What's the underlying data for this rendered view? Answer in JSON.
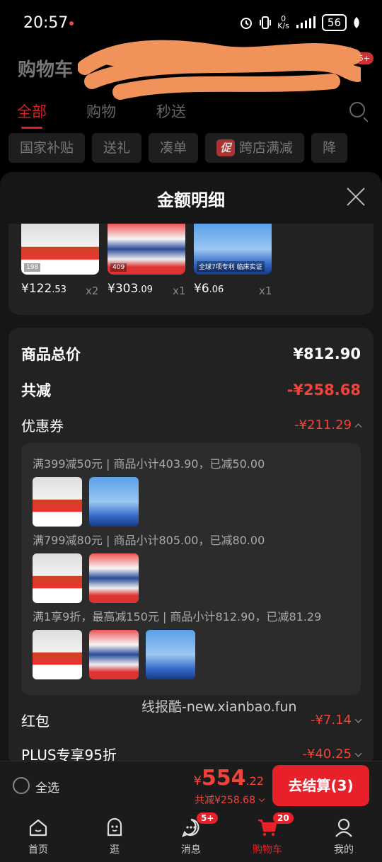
{
  "status_bar": {
    "time": "20:57",
    "net_speed": "0\nK/s",
    "battery": "56"
  },
  "header": {
    "title": "购物车",
    "badge": "5+"
  },
  "tabs": [
    {
      "label": "全部",
      "active": true
    },
    {
      "label": "购物",
      "active": false
    },
    {
      "label": "秒送",
      "active": false
    }
  ],
  "chips": [
    {
      "label": "国家补贴"
    },
    {
      "label": "送礼"
    },
    {
      "label": "凑单"
    },
    {
      "label": "跨店满减",
      "tag": "促"
    },
    {
      "label": "降"
    }
  ],
  "sheet": {
    "title": "金额明细"
  },
  "products": [
    {
      "price_int": "¥122",
      "price_dec": ".53",
      "qty": "x2",
      "art_label": "198"
    },
    {
      "price_int": "¥303",
      "price_dec": ".09",
      "qty": "x1",
      "art_label": "409"
    },
    {
      "price_int": "¥6",
      "price_dec": ".06",
      "qty": "x1",
      "art_label": "全球7项专利 临床实证"
    }
  ],
  "summary": {
    "total_label": "商品总价",
    "total_value": "¥812.90",
    "reduce_label": "共减",
    "reduce_value": "-¥258.68",
    "coupon_label": "优惠券",
    "coupon_value": "-¥211.29",
    "coupon_lines": [
      "满399减50元 | 商品小计403.90，已减50.00",
      "满799减80元 | 商品小计805.00，已减80.00",
      "满1享9折，最高减150元 | 商品小计812.90，已减81.29"
    ],
    "redpack_label": "红包",
    "redpack_value": "-¥7.14",
    "plus_label": "PLUS专享95折",
    "plus_value": "-¥40.25"
  },
  "watermark": "线报酷-new.xianbao.fun",
  "checkout": {
    "select_all": "全选",
    "currency": "¥",
    "amount_int": "554",
    "amount_dec": ".22",
    "saved": "共减¥258.68",
    "pay_label": "去结算(3)"
  },
  "nav": [
    {
      "label": "首页",
      "icon": "home-icon"
    },
    {
      "label": "逛",
      "icon": "browse-icon"
    },
    {
      "label": "消息",
      "icon": "message-icon",
      "badge": "5+"
    },
    {
      "label": "购物车",
      "icon": "cart-icon",
      "badge": "20",
      "active": true
    },
    {
      "label": "我的",
      "icon": "profile-icon"
    }
  ]
}
